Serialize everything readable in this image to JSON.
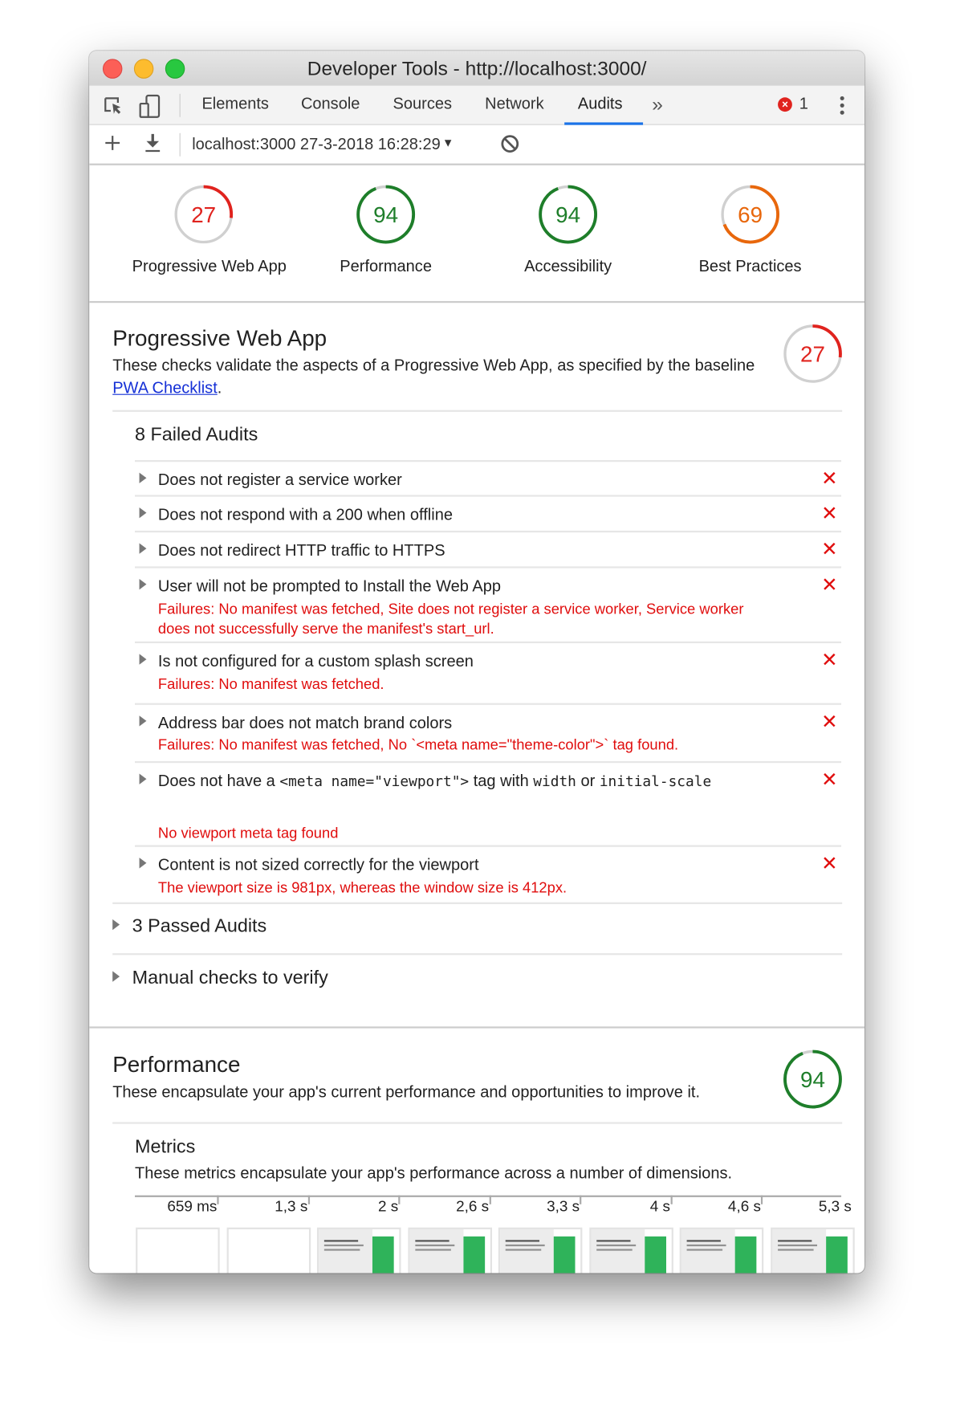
{
  "window": {
    "title": "Developer Tools - http://localhost:3000/"
  },
  "tabs": [
    {
      "label": "Elements"
    },
    {
      "label": "Console"
    },
    {
      "label": "Sources"
    },
    {
      "label": "Network"
    },
    {
      "label": "Audits",
      "active": true
    }
  ],
  "tab_overflow": "»",
  "error_count": "1",
  "toolbar": {
    "report_select": "localhost:3000 27-3-2018 16:28:29"
  },
  "colors": {
    "fail": "#e0231e",
    "average": "#e8670c",
    "pass": "#1e7e2a",
    "track": "#d0d0d0",
    "link": "#1530d6"
  },
  "scores": [
    {
      "label": "Progressive Web App",
      "score": 27
    },
    {
      "label": "Performance",
      "score": 94
    },
    {
      "label": "Accessibility",
      "score": 94
    },
    {
      "label": "Best Practices",
      "score": 69
    }
  ],
  "pwa": {
    "title": "Progressive Web App",
    "score": 27,
    "desc_before": "These checks validate the aspects of a Progressive Web App, as specified by the baseline ",
    "link": "PWA Checklist",
    "desc_after": ".",
    "failed_title": "8 Failed Audits",
    "audits": [
      {
        "title": "Does not register a service worker"
      },
      {
        "title": "Does not respond with a 200 when offline"
      },
      {
        "title": "Does not redirect HTTP traffic to HTTPS"
      },
      {
        "title": "User will not be prompted to Install the Web App",
        "error": "Failures: No manifest was fetched, Site does not register a service worker, Service worker does not successfully serve the manifest's start_url."
      },
      {
        "title": "Is not configured for a custom splash screen",
        "error": "Failures: No manifest was fetched."
      },
      {
        "title": "Address bar does not match brand colors",
        "error": "Failures: No manifest was fetched, No `<meta name=\"theme-color\">` tag found."
      },
      {
        "title_parts": [
          "Does not have a ",
          "<meta name=\"viewport\">",
          " tag with ",
          "width",
          " or ",
          "initial-scale"
        ],
        "error": "No viewport meta tag found"
      },
      {
        "title": "Content is not sized correctly for the viewport",
        "error": "The viewport size is 981px, whereas the window size is 412px."
      }
    ],
    "passed_title": "3 Passed Audits",
    "manual_title": "Manual checks to verify"
  },
  "performance": {
    "title": "Performance",
    "score": 94,
    "desc": "These encapsulate your app's current performance and opportunities to improve it.",
    "metrics_title": "Metrics",
    "metrics_desc": "These metrics encapsulate your app's performance across a number of dimensions.",
    "filmstrip": [
      "659 ms",
      "1,3 s",
      "2 s",
      "2,6 s",
      "3,3 s",
      "4 s",
      "4,6 s",
      "5,3 s"
    ]
  }
}
